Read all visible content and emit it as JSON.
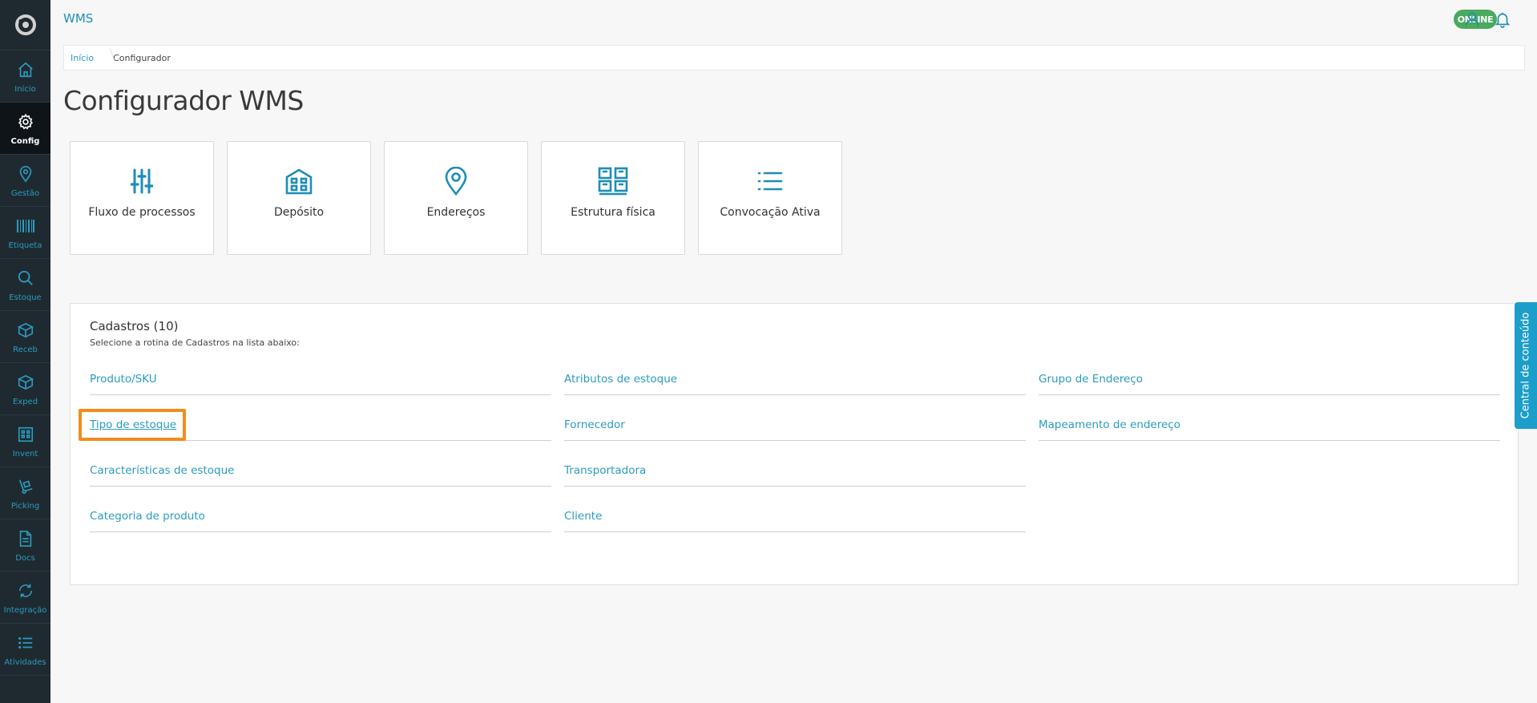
{
  "app": {
    "title": "WMS"
  },
  "status": {
    "online_label": "ONLINE",
    "online_color": "#4aaa5e"
  },
  "sidebar": {
    "items": [
      {
        "label": "Início",
        "icon": "home-icon"
      },
      {
        "label": "Config",
        "icon": "gear-icon",
        "active": true
      },
      {
        "label": "Gestão",
        "icon": "map-pin-icon"
      },
      {
        "label": "Etiqueta",
        "icon": "barcode-icon"
      },
      {
        "label": "Estoque",
        "icon": "search-icon"
      },
      {
        "label": "Receb",
        "icon": "box-in-icon"
      },
      {
        "label": "Exped",
        "icon": "box-out-icon"
      },
      {
        "label": "Invent",
        "icon": "building-icon"
      },
      {
        "label": "Picking",
        "icon": "hand-truck-icon"
      },
      {
        "label": "Docs",
        "icon": "document-icon"
      },
      {
        "label": "Integração",
        "icon": "sync-icon"
      },
      {
        "label": "Atividades",
        "icon": "list-icon"
      }
    ]
  },
  "breadcrumb": {
    "home": "Início",
    "current": "Configurador"
  },
  "page": {
    "title": "Configurador WMS"
  },
  "cards": [
    {
      "label": "Fluxo de processos",
      "icon": "sliders-icon"
    },
    {
      "label": "Depósito",
      "icon": "warehouse-icon"
    },
    {
      "label": "Endereços",
      "icon": "location-pin-icon"
    },
    {
      "label": "Estrutura física",
      "icon": "pallet-rack-icon"
    },
    {
      "label": "Convocação Ativa",
      "icon": "list-icon"
    }
  ],
  "cadastros": {
    "title": "Cadastros (10)",
    "subtitle": "Selecione a rotina de Cadastros na lista abaixo:",
    "col1": [
      "Produto/SKU",
      "Tipo de estoque",
      "Características de estoque",
      "Categoria de produto"
    ],
    "col2": [
      "Atributos de estoque",
      "Fornecedor",
      "Transportadora",
      "Cliente"
    ],
    "col3": [
      "Grupo de Endereço",
      "Mapeamento de endereço"
    ]
  },
  "side_tab": {
    "label": "Central de conteúdo"
  },
  "colors": {
    "accent": "#1e8db5",
    "sidebar_bg": "#1f2a30",
    "highlight": "#f28c1e"
  }
}
